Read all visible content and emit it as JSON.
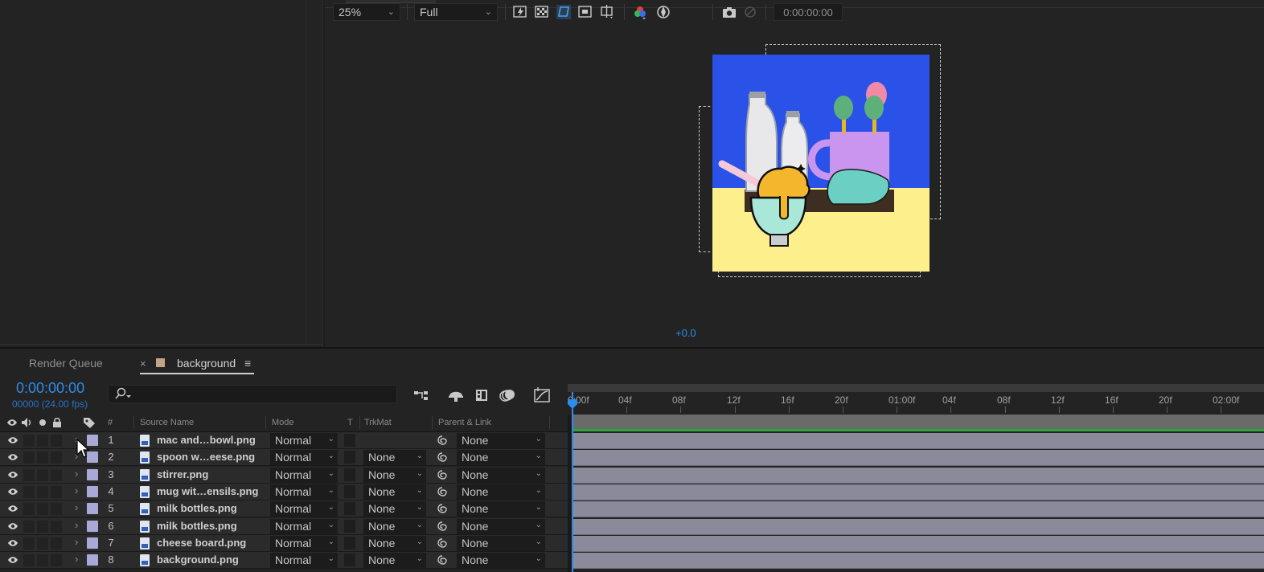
{
  "viewer": {
    "zoom": "25%",
    "resolution": "Full",
    "exposure": "+0.0",
    "timecode": "0:00:00:00"
  },
  "timeline": {
    "tabs": [
      {
        "label": "Render Queue"
      },
      {
        "label": "background"
      }
    ],
    "close_glyph": "×",
    "menu_glyph": "≡",
    "timecode": "0:00:00:00",
    "fps": "00000 (24.00 fps)",
    "columns": {
      "num": "#",
      "source_name": "Source Name",
      "mode": "Mode",
      "t": "T",
      "trkmat": "TrkMat",
      "parent": "Parent & Link"
    },
    "ruler_labels": [
      "0:00f",
      "04f",
      "08f",
      "12f",
      "16f",
      "20f",
      "01:00f",
      "04f",
      "08f",
      "12f",
      "16f",
      "20f",
      "02:00f"
    ],
    "layers": [
      {
        "num": "1",
        "name": "mac and…bowl.png",
        "mode": "Normal",
        "trkmat": "",
        "parent": "None"
      },
      {
        "num": "2",
        "name": "spoon w…eese.png",
        "mode": "Normal",
        "trkmat": "None",
        "parent": "None"
      },
      {
        "num": "3",
        "name": "stirrer.png",
        "mode": "Normal",
        "trkmat": "None",
        "parent": "None"
      },
      {
        "num": "4",
        "name": "mug wit…ensils.png",
        "mode": "Normal",
        "trkmat": "None",
        "parent": "None"
      },
      {
        "num": "5",
        "name": "milk bottles.png",
        "mode": "Normal",
        "trkmat": "None",
        "parent": "None"
      },
      {
        "num": "6",
        "name": "milk bottles.png",
        "mode": "Normal",
        "trkmat": "None",
        "parent": "None"
      },
      {
        "num": "7",
        "name": "cheese board.png",
        "mode": "Normal",
        "trkmat": "None",
        "parent": "None"
      },
      {
        "num": "8",
        "name": "background.png",
        "mode": "Normal",
        "trkmat": "None",
        "parent": "None"
      }
    ]
  },
  "colors": {
    "accent": "#2d8ceb",
    "label": "#a9a9d8",
    "track": "#8a8a9a",
    "comp_sky": "#2a52e8",
    "comp_table": "#fcef8c"
  }
}
